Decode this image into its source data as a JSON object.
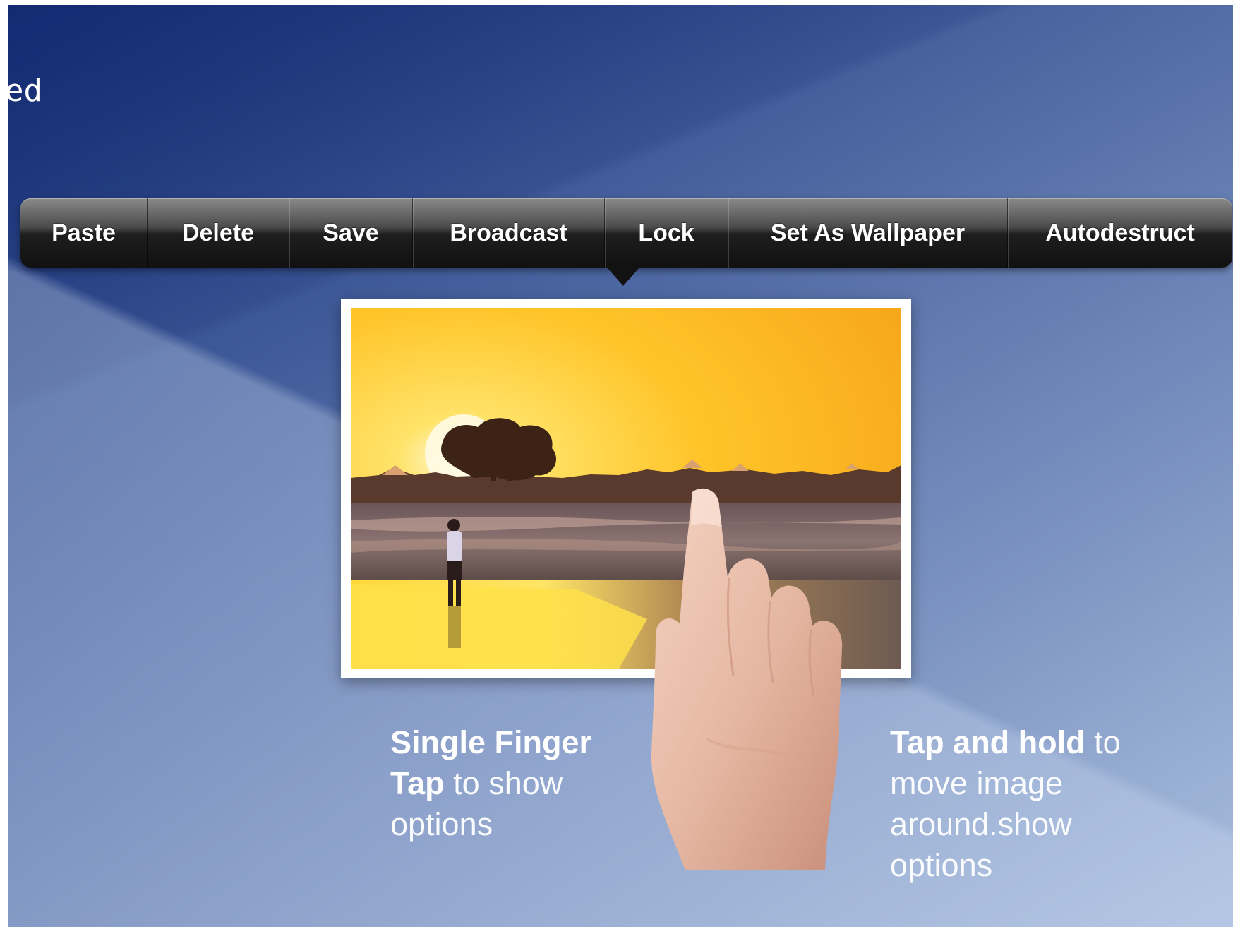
{
  "corner_label": "ed",
  "context_menu": {
    "items": [
      {
        "label": "Paste"
      },
      {
        "label": "Delete"
      },
      {
        "label": "Save"
      },
      {
        "label": "Broadcast"
      },
      {
        "label": "Lock"
      },
      {
        "label": "Set As Wallpaper"
      },
      {
        "label": "Autodestruct"
      }
    ]
  },
  "photo": {
    "subject": "sunset-beach-photo"
  },
  "captions": {
    "left": {
      "bold1": "Single Finger",
      "bold2": "Tap",
      "rest1": " to show",
      "rest2": "options"
    },
    "right": {
      "bold1": "Tap and hold",
      "rest1": " to",
      "rest2": "move image",
      "rest3": "around.show",
      "rest4": "options"
    }
  },
  "colors": {
    "background_top": "#1e3a82",
    "background_bottom": "#a9bedd",
    "menu_dark": "#111111",
    "sun": "#ffd030"
  }
}
